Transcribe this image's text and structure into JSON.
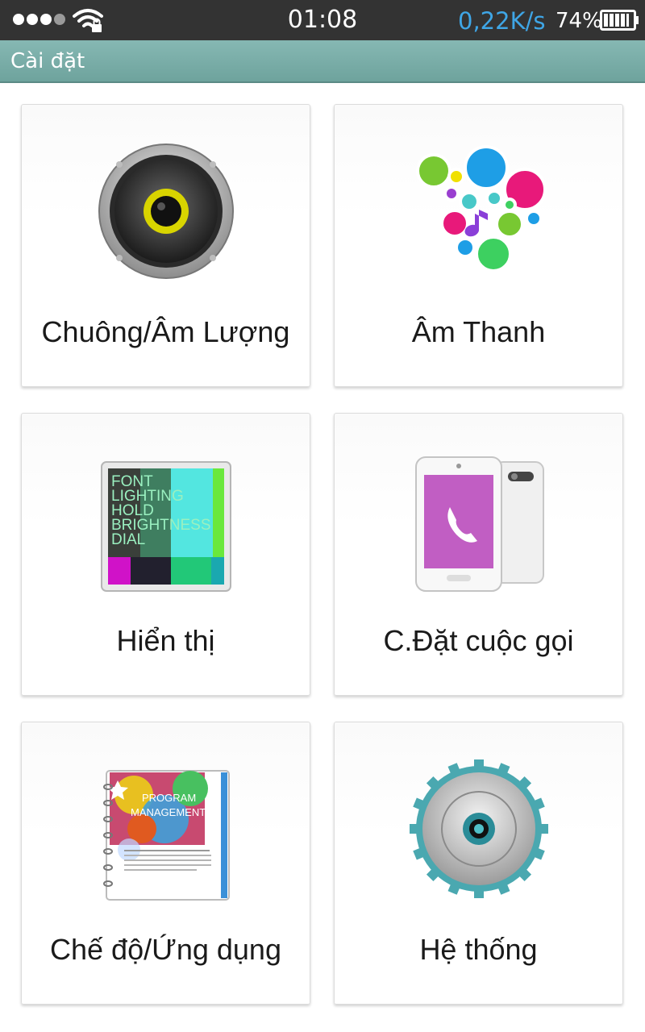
{
  "status_bar": {
    "time": "01:08",
    "net_speed": "0,22K/s",
    "battery_percent": "74%",
    "battery_level": 0.74,
    "signal_icon": "signal-dots-icon",
    "wifi_icon": "wifi-locked-icon",
    "net_speed_color": "#3fa6e6"
  },
  "title_bar": {
    "title": "Cài đặt",
    "color": "#7aaea8"
  },
  "tiles": [
    {
      "label": "Chuông/Âm Lượng",
      "icon": "speaker-icon"
    },
    {
      "label": "Âm Thanh",
      "icon": "music-bubbles-icon"
    },
    {
      "label": "Hiển thị",
      "icon": "display-icon",
      "icon_text": [
        "FONT",
        "LIGHTING",
        "HOLD",
        "BRIGHTNESS",
        "DIAL"
      ]
    },
    {
      "label": "C.Đặt cuộc gọi",
      "icon": "phone-call-icon"
    },
    {
      "label": "Chế độ/Ứng dụng",
      "icon": "program-book-icon",
      "icon_text": [
        "PROGRAM",
        "MANAGEMENT"
      ]
    },
    {
      "label": "Hệ thống",
      "icon": "gear-icon"
    }
  ]
}
